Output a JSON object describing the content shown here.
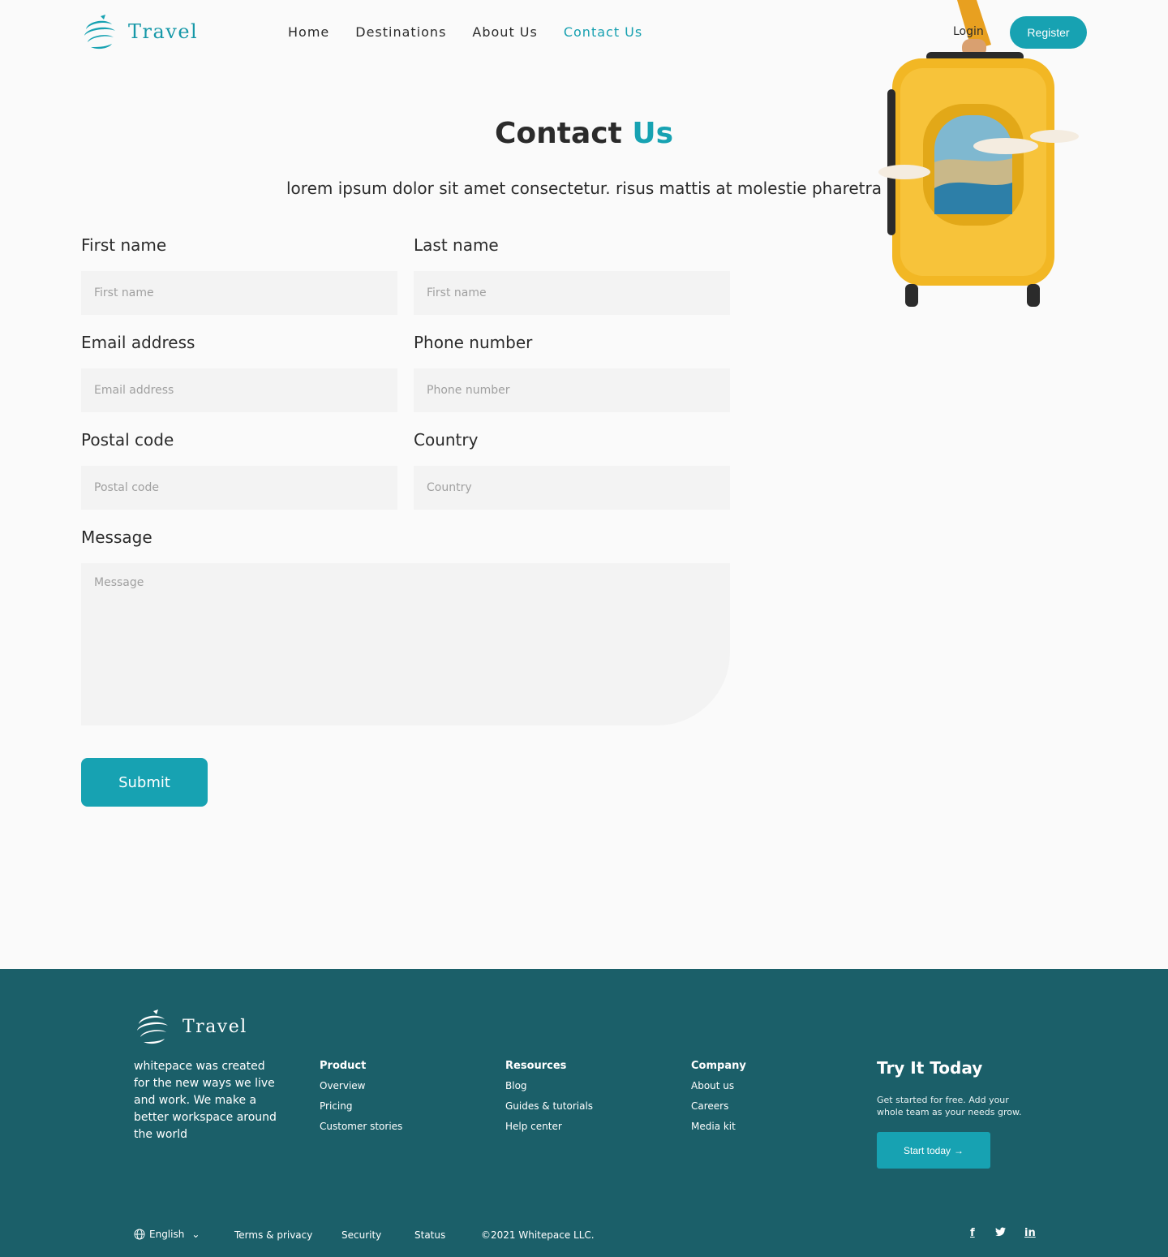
{
  "brand": {
    "name": "Travel",
    "color": "#17a2b2"
  },
  "nav": {
    "items": [
      {
        "label": "Home"
      },
      {
        "label": "Destinations"
      },
      {
        "label": "About Us"
      },
      {
        "label": "Contact Us"
      }
    ],
    "active": "Contact Us",
    "login": "Login",
    "register": "Register"
  },
  "hero": {
    "title_main": "Contact",
    "title_accent": "Us",
    "subtitle": "lorem ipsum dolor sit amet consectetur. risus mattis at molestie pharetra"
  },
  "form": {
    "first_name": {
      "label": "First name",
      "placeholder": "First name"
    },
    "last_name": {
      "label": "Last name",
      "placeholder": "First name"
    },
    "email": {
      "label": "Email address",
      "placeholder": "Email address"
    },
    "phone": {
      "label": "Phone number",
      "placeholder": "Phone number"
    },
    "postal": {
      "label": "Postal code",
      "placeholder": "Postal code"
    },
    "country": {
      "label": "Country",
      "placeholder": "Country"
    },
    "message": {
      "label": "Message",
      "placeholder": "Message"
    },
    "submit": "Submit"
  },
  "footer": {
    "brand": "Travel",
    "about": "whitepace was created for the new ways we live and work. We make a better workspace around the world",
    "columns": [
      {
        "title": "Product",
        "links": [
          "Overview",
          "Pricing",
          "Customer stories"
        ]
      },
      {
        "title": "Resources",
        "links": [
          "Blog",
          "Guides & tutorials",
          "Help center"
        ]
      },
      {
        "title": "Company",
        "links": [
          "About us",
          "Careers",
          "Media kit"
        ]
      }
    ],
    "try": {
      "title": "Try It Today",
      "text": "Get started for free. Add your whole team as your needs grow.",
      "button": "Start today"
    },
    "bottom": {
      "language": "English",
      "terms": "Terms & privacy",
      "security": "Security",
      "status": "Status",
      "copyright": "©2021 Whitepace LLC."
    },
    "social": [
      "facebook-icon",
      "twitter-icon",
      "linkedin-icon"
    ],
    "background": "#1b5f69"
  }
}
